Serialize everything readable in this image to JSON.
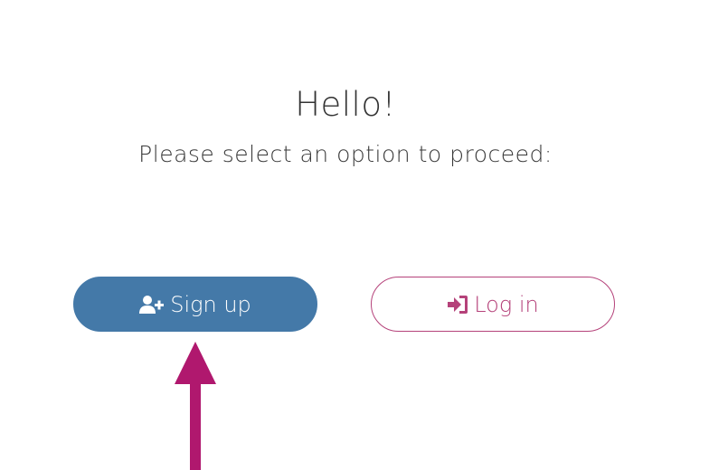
{
  "heading": {
    "title": "Hello!",
    "subtitle": "Please select an option to proceed:"
  },
  "actions": {
    "signup": {
      "label": "Sign up",
      "icon": "user-plus-icon",
      "color": "#4479a8"
    },
    "login": {
      "label": "Log in",
      "icon": "sign-in-icon",
      "color": "#b5427a"
    }
  },
  "annotation": {
    "arrow_color": "#b0186e",
    "arrow_icon": "up-arrow-icon"
  }
}
